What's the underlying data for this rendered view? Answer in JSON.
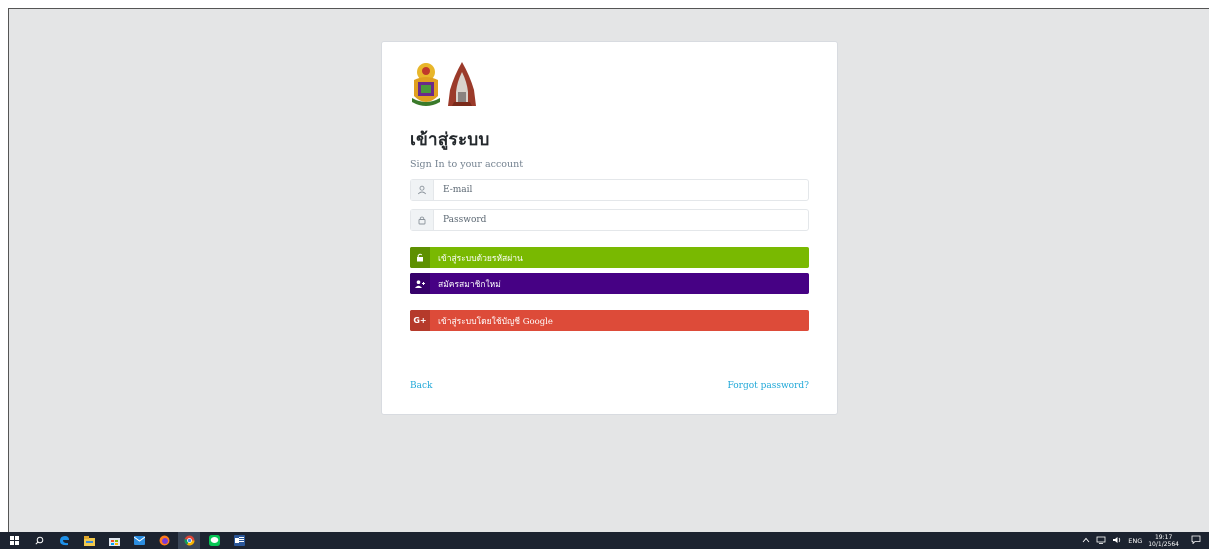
{
  "login": {
    "title": "เข้าสู่ระบบ",
    "subtitle": "Sign In to your account",
    "email_placeholder": "E-mail",
    "password_placeholder": "Password",
    "password_login_label": "เข้าสู่ระบบด้วยรหัสผ่าน",
    "register_label": "สมัครสมาชิกใหม่",
    "google_login_label": "เข้าสู่ระบบโดยใช้บัญชี Google",
    "back_label": "Back",
    "forgot_label": "Forgot password?"
  },
  "colors": {
    "green": "#79b901",
    "purple": "#460184",
    "red": "#dd4b39",
    "link": "#20a8d8"
  },
  "icons": [
    "user-icon",
    "lock-icon",
    "unlock-icon",
    "add-user-icon",
    "google-plus-icon"
  ],
  "taskbar": {
    "lang": "ENG",
    "time": "19:17",
    "date": "10/1/2564"
  }
}
